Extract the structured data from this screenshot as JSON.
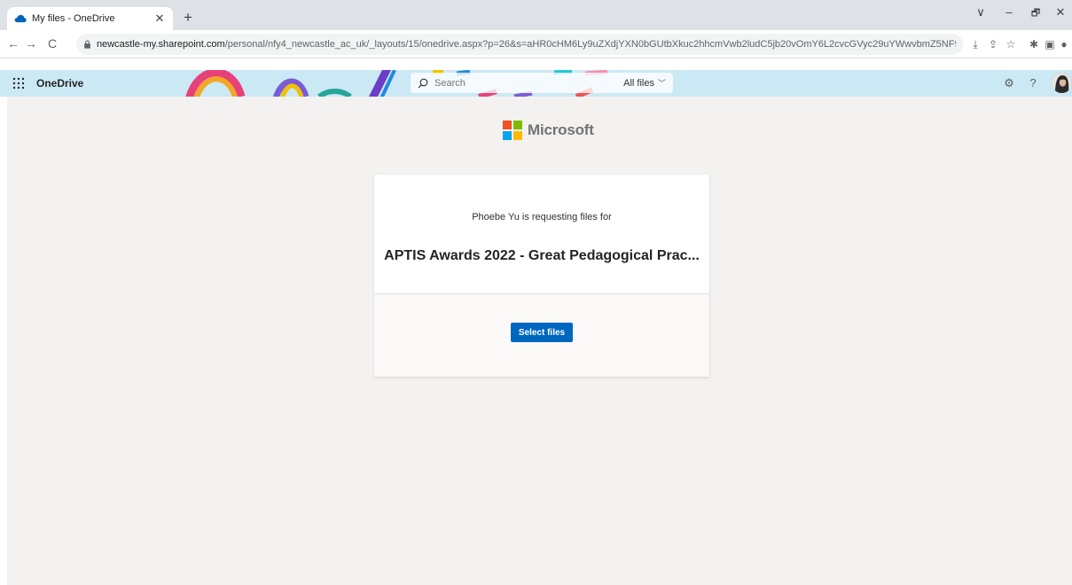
{
  "browser": {
    "tab_title": "My files - OneDrive",
    "tab_close": "✕",
    "new_tab": "+",
    "url_host": "newcastle-my.sharepoint.com",
    "url_path": "/personal/nfy4_newcastle_ac_uk/_layouts/15/onedrive.aspx?p=26&s=aHR0cHM6Ly9uZXdjYXN0bGUtbXkuc2hhcmVwb2ludC5jb20vOmY6L2cvcGVyc29uYWwvbmZ5NF9uZXdjYXN0bGVfYWNfdWsvRWtMenBKdC1IMzlIdk...",
    "window_controls": [
      "∨",
      "–",
      "🗗",
      "✕"
    ]
  },
  "header": {
    "app_name": "OneDrive",
    "search_placeholder": "Search",
    "search_scope": "All files",
    "settings_glyph": "⚙",
    "help_glyph": "?"
  },
  "main": {
    "brand": "Microsoft",
    "logo_colors": [
      "#f25022",
      "#7fba00",
      "#00a4ef",
      "#ffb900"
    ],
    "requester_text": "Phoebe Yu is requesting files for",
    "request_title": "APTIS Awards 2022 - Great Pedagogical Prac...",
    "select_files_label": "Select files",
    "accent_color": "#0067c0"
  }
}
